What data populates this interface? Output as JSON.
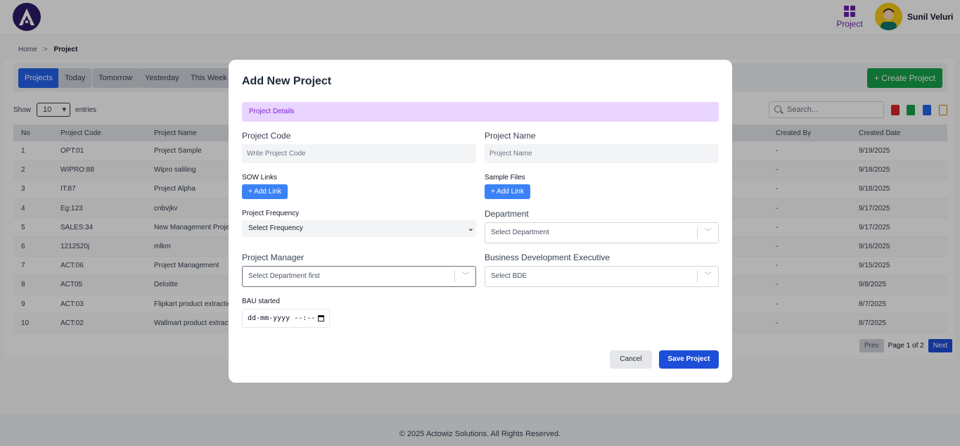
{
  "header": {
    "logo_icon": "actowiz-logo-icon",
    "nav_project_label": "Project",
    "user_name": "Sunil Veluri"
  },
  "breadcrumb": {
    "home": "Home",
    "separator": ">",
    "current": "Project"
  },
  "filters": {
    "tabs": [
      {
        "label": "Projects",
        "active": true
      },
      {
        "label": "Today",
        "active": false
      },
      {
        "label": "Tomorrow",
        "active": false
      },
      {
        "label": "Yesterday",
        "active": false
      },
      {
        "label": "This Week",
        "active": false
      }
    ],
    "create_button": "+ Create Project"
  },
  "table_controls": {
    "show_label": "Show",
    "page_size": "10",
    "entries_label": "entries",
    "search_placeholder": "Search...",
    "export_icons": [
      "pdf-icon",
      "excel-icon",
      "csv-icon",
      "doc-icon"
    ]
  },
  "table": {
    "columns": [
      "No",
      "Project Code",
      "Project Name",
      "Created By",
      "Created Date"
    ],
    "rows": [
      [
        "1",
        "OPT:01",
        "Project Sample",
        "-",
        "9/19/2025"
      ],
      [
        "2",
        "WIPRO:88",
        "Wipro saliling",
        "-",
        "9/18/2025"
      ],
      [
        "3",
        "IT:87",
        "Project Alpha",
        "-",
        "9/18/2025"
      ],
      [
        "4",
        "Eg:123",
        "cnbvjkv",
        "-",
        "9/17/2025"
      ],
      [
        "5",
        "SALES:34",
        "New Management Projec",
        "-",
        "9/17/2025"
      ],
      [
        "6",
        "1212520j",
        "mlkm",
        "-",
        "9/16/2025"
      ],
      [
        "7",
        "ACT:06",
        "Project Management",
        "-",
        "9/15/2025"
      ],
      [
        "8",
        "ACT05",
        "Deloitte",
        "-",
        "9/8/2025"
      ],
      [
        "9",
        "ACT:03",
        "Flipkart product extractio",
        "-",
        "8/7/2025"
      ],
      [
        "10",
        "ACT:02",
        "Wallmart product extract",
        "-",
        "8/7/2025"
      ]
    ]
  },
  "pagination": {
    "prev": "Prev",
    "info": "Page 1 of 2",
    "next": "Next"
  },
  "footer": {
    "text": "© 2025 Actowiz Solutions. All Rights Reserved."
  },
  "modal": {
    "title": "Add New Project",
    "section": "Project Details",
    "project_code_label": "Project Code",
    "project_code_placeholder": "Write Project Code",
    "project_name_label": "Project Name",
    "project_name_placeholder": "Project Name",
    "sow_links_label": "SOW Links",
    "sample_files_label": "Sample Files",
    "add_link": "+ Add Link",
    "frequency_label": "Project Frequency",
    "frequency_value": "Select Frequency",
    "department_label": "Department",
    "department_placeholder": "Select Department",
    "manager_label": "Project Manager",
    "manager_placeholder": "Select Department first",
    "bde_label": "Business Development Executive",
    "bde_placeholder": "Select BDE",
    "bau_label": "BAU started",
    "bau_value": "dd-mm-yyyy --:--",
    "cancel": "Cancel",
    "save": "Save Project"
  },
  "colors": {
    "primary": "#2563eb",
    "success": "#16a34a",
    "brand_purple": "#6b21a8",
    "section_bg": "#e9d5ff"
  }
}
